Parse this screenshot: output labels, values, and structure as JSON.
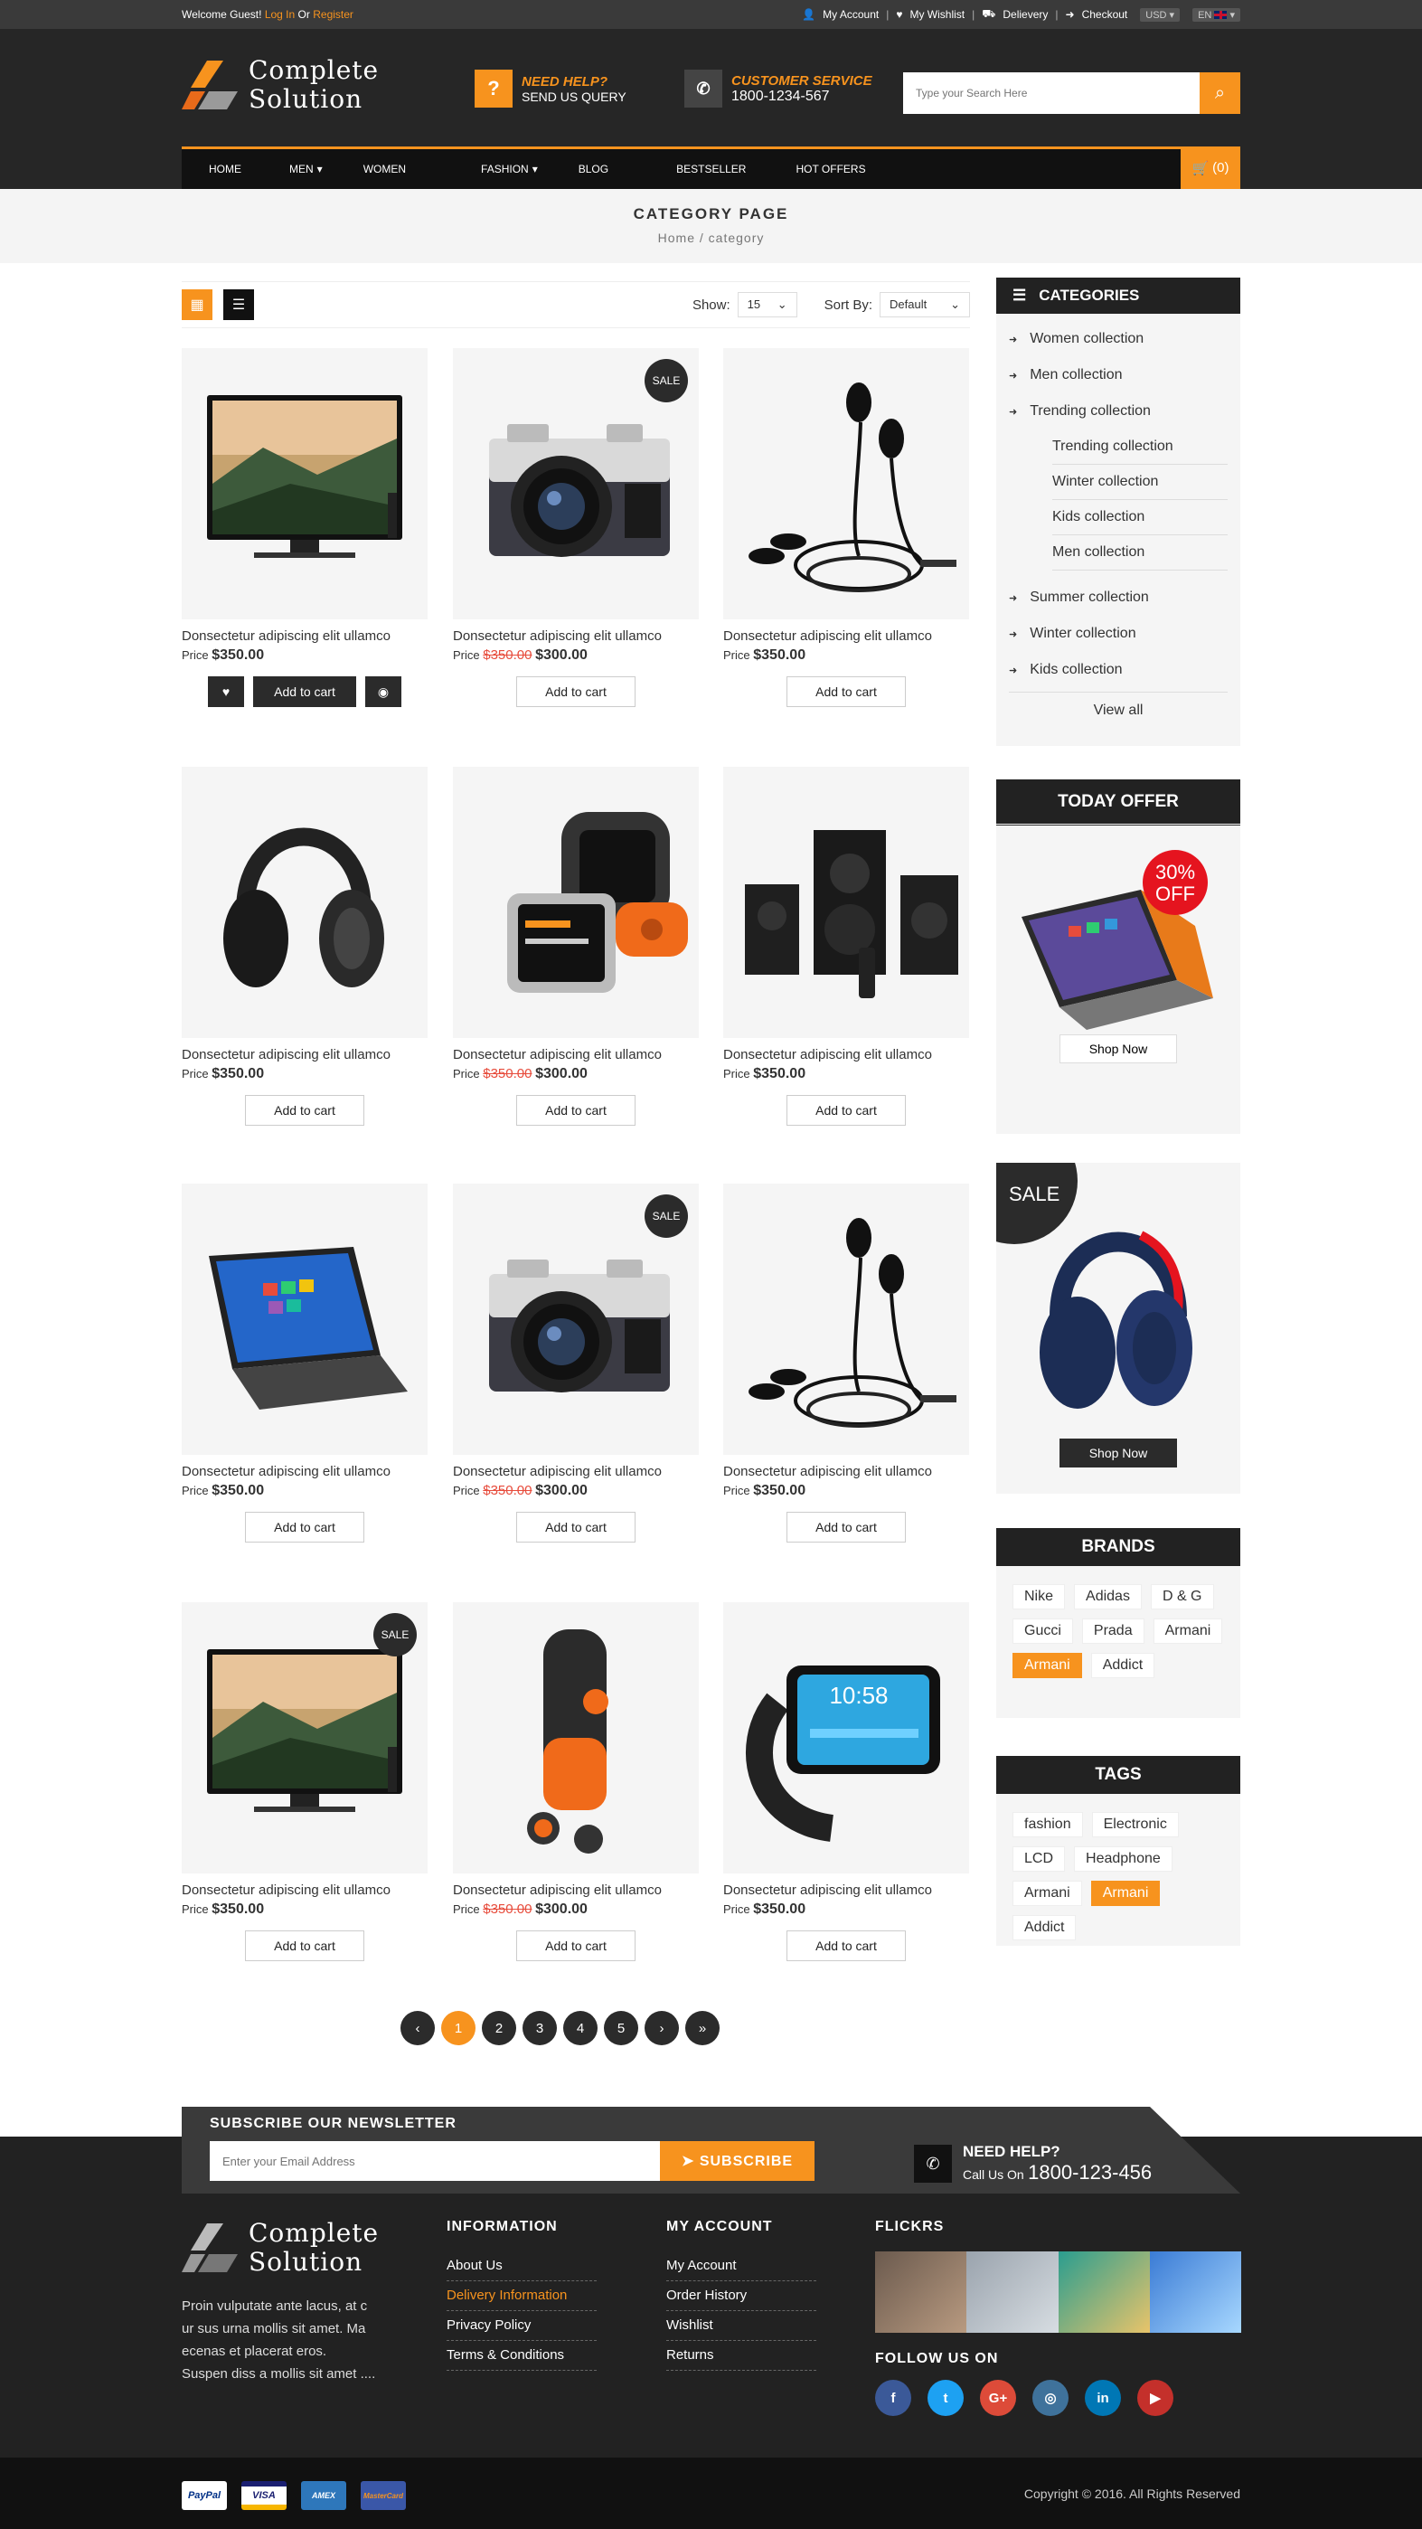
{
  "topbar": {
    "welcome": "Welcome Guest!",
    "login": "Log In",
    "or": "Or",
    "register": "Register",
    "links": [
      "My Account",
      "My Wishlist",
      "Delievery",
      "Checkout"
    ],
    "currency": "USD",
    "language": "EN"
  },
  "header": {
    "logo_line1": "Complete",
    "logo_line2": "Solution",
    "help_title": "NEED HELP?",
    "help_sub": "SEND US QUERY",
    "service_title": "CUSTOMER SERVICE",
    "service_phone": "1800-1234-567",
    "search_placeholder": "Type your Search Here"
  },
  "nav": {
    "items": [
      "HOME",
      "MEN",
      "WOMEN",
      "FASHION",
      "BLOG",
      "BESTSELLER",
      "HOT OFFERS"
    ],
    "cart": "(0)"
  },
  "crumbs": {
    "title": "CATEGORY PAGE",
    "path": "Home / category"
  },
  "toolbar": {
    "show_label": "Show:",
    "show_value": "15",
    "sort_label": "Sort By:",
    "sort_value": "Default"
  },
  "products": [
    {
      "title": "Donsectetur adipiscing elit ullamco",
      "price_label": "Price",
      "old": "",
      "price": "$350.00",
      "img": "tv"
    },
    {
      "title": "Donsectetur adipiscing elit ullamco",
      "price_label": "Price",
      "old": "$350.00",
      "price": "$300.00",
      "img": "camera",
      "sale": "SALE"
    },
    {
      "title": "Donsectetur adipiscing elit ullamco",
      "price_label": "Price",
      "old": "",
      "price": "$350.00",
      "img": "earphones"
    },
    {
      "title": "Donsectetur adipiscing elit ullamco",
      "price_label": "Price",
      "old": "",
      "price": "$350.00",
      "img": "headphones"
    },
    {
      "title": "Donsectetur adipiscing elit ullamco",
      "price_label": "Price",
      "old": "$350.00",
      "price": "$300.00",
      "img": "watch"
    },
    {
      "title": "Donsectetur adipiscing elit ullamco",
      "price_label": "Price",
      "old": "",
      "price": "$350.00",
      "img": "speakers"
    },
    {
      "title": "Donsectetur adipiscing elit ullamco",
      "price_label": "Price",
      "old": "",
      "price": "$350.00",
      "img": "laptop"
    },
    {
      "title": "Donsectetur adipiscing elit ullamco",
      "price_label": "Price",
      "old": "$350.00",
      "price": "$300.00",
      "img": "camera",
      "sale": "SALE"
    },
    {
      "title": "Donsectetur adipiscing elit ullamco",
      "price_label": "Price",
      "old": "",
      "price": "$350.00",
      "img": "earphones"
    },
    {
      "title": "Donsectetur adipiscing elit ullamco",
      "price_label": "Price",
      "old": "",
      "price": "$350.00",
      "img": "tv",
      "sale": "SALE"
    },
    {
      "title": "Donsectetur adipiscing elit ullamco",
      "price_label": "Price",
      "old": "$350.00",
      "price": "$300.00",
      "img": "earbuds"
    },
    {
      "title": "Donsectetur adipiscing elit ullamco",
      "price_label": "Price",
      "old": "",
      "price": "$350.00",
      "img": "smartwatch"
    }
  ],
  "add_to_cart": "Add to cart",
  "pagination": [
    "1",
    "2",
    "3",
    "4",
    "5"
  ],
  "sidebar": {
    "categories_title": "CATEGORIES",
    "categories": [
      "Women collection",
      "Men collection",
      "Trending collection"
    ],
    "subcategories": [
      "Trending collection",
      "Winter collection",
      "Kids collection",
      "Men collection"
    ],
    "categories_more": [
      "Summer collection",
      "Winter collection",
      "Kids collection"
    ],
    "view_all": "View all",
    "offer_title": "TODAY OFFER",
    "offer_badge_1": "30%",
    "offer_badge_2": "OFF",
    "shop_now": "Shop Now",
    "sale_label": "SALE",
    "brands_title": "BRANDS",
    "brands": [
      "Nike",
      "Adidas",
      "D & G",
      "Gucci",
      "Prada",
      "Armani",
      "Armani",
      "Addict"
    ],
    "tags_title": "TAGS",
    "tags": [
      "fashion",
      "Electronic",
      "LCD",
      "Headphone",
      "Armani",
      "Armani",
      "Addict"
    ]
  },
  "newsletter": {
    "title": "SUBSCRIBE OUR NEWSLETTER",
    "placeholder": "Enter your Email Address",
    "button": "SUBSCRIBE",
    "help_title": "NEED HELP?",
    "call_label": "Call Us On",
    "phone": "1800-123-456"
  },
  "footer": {
    "desc": "Proin vulputate ante lacus, at c ur sus urna mollis sit amet. Ma ecenas et placerat eros. Suspen diss a mollis sit amet ....",
    "info_title": "INFORMATION",
    "info_links": [
      "About Us",
      "Delivery Information",
      "Privacy Policy",
      "Terms & Conditions"
    ],
    "account_title": "MY ACCOUNT",
    "account_links": [
      "My Account",
      "Order History",
      "Wishlist",
      "Returns"
    ],
    "flickr_title": "FLICKRS",
    "follow_title": "FOLLOW US ON",
    "social": [
      {
        "name": "facebook-icon",
        "glyph": "f",
        "color": "#3b5998"
      },
      {
        "name": "twitter-icon",
        "glyph": "t",
        "color": "#1da1f2"
      },
      {
        "name": "google-plus-icon",
        "glyph": "G+",
        "color": "#dd4b39"
      },
      {
        "name": "instagram-icon",
        "glyph": "◎",
        "color": "#3f729b"
      },
      {
        "name": "linkedin-icon",
        "glyph": "in",
        "color": "#0077b5"
      },
      {
        "name": "youtube-icon",
        "glyph": "▶",
        "color": "#c4302b"
      }
    ]
  },
  "bottom": {
    "cards": [
      "PayPal",
      "VISA",
      "AMEX",
      "MasterCard"
    ],
    "copyright": "Copyright © 2016. All Rights Reserved"
  },
  "colors": {
    "accent": "#f7931e",
    "dark": "#222222"
  }
}
